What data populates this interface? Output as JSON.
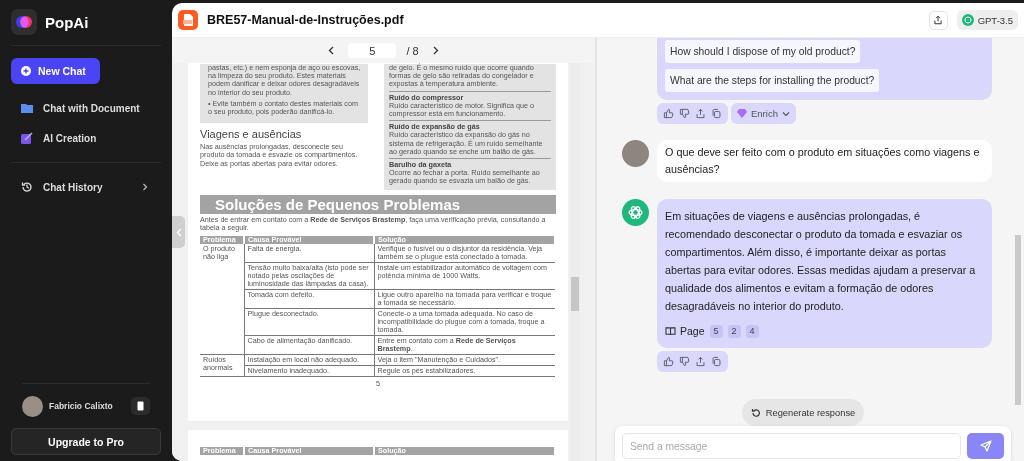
{
  "sidebar": {
    "brand": "PopAi",
    "new_chat": "New Chat",
    "items": [
      {
        "label": "Chat with Document",
        "kind": "document"
      },
      {
        "label": "AI Creation",
        "kind": "creation"
      }
    ],
    "history": "Chat History",
    "user": {
      "name": "Fabricio Calixto"
    },
    "upgrade": "Upgrade to Pro"
  },
  "document": {
    "file_name": "BRE57-Manual-de-Instruções.pdf",
    "page_input": "5",
    "page_total": "/ 8",
    "left_box": [
      "pastas, etc.) e nem esponja de aço ou escovas, na limpeza do seu produto. Estes materiais podem danificar e deixar odores desagradáveis no interior do seu produto.",
      "• Evite também o contato destes materiais com o seu produto, pois poderão danificá-lo."
    ],
    "section_title": "Viagens e ausências",
    "section_text": "Nas ausências prolongadas, desconecte seu produto da tomada e esvazie os compartimentos. Deixe as portas abertas para evitar odores.",
    "noises": [
      {
        "text": "de gelo. É o mesmo ruído que ocorre quando formas de gelo são retiradas do congelador e expostas à temperatura ambiente."
      },
      {
        "title": "Ruído do compressor",
        "text": "Ruído característico de motor. Significa que o compressor está em funcionamento."
      },
      {
        "title": "Ruído de expansão de gás",
        "text": "Ruído característico da expansão do gás no sistema de refrigeração. É um ruído semelhante ao gerado quando se enche um balão de gás."
      },
      {
        "title": "Barulho da gaxeta",
        "text": "Ocorre ao fechar a porta. Ruído semelhante ao gerado quando se esvazia um balão de gás."
      }
    ],
    "heading": "Soluções de Pequenos Problemas",
    "intro": "Antes de entrar em contato com a **Rede de Serviços Brastemp**, faça uma verificação prévia, consultando a tabela a seguir.",
    "table": {
      "columns": [
        "Problema",
        "Causa Provável",
        "Solução"
      ],
      "groups": [
        {
          "problem": "O produto não liga",
          "rows": [
            {
              "cause": "Falta de energia.",
              "solution": "Verifique o fusível ou o disjuntor da residência. Veja também se o plugue está conectado à tomada."
            },
            {
              "cause": "Tensão muito baixa/alta (isto pode ser notado pelas oscilações de luminosidade das lâmpadas da casa).",
              "solution": "Instale um estabilizador automático de voltagem com potência mínima de 1000 Watts."
            },
            {
              "cause": "Tomada com defeito.",
              "solution": "Ligue outro aparelho na tomada para verificar e troque a tomada se necessário."
            },
            {
              "cause": "Plugue desconectado.",
              "solution": "Conecte-o a uma tomada adequada. No caso de incompatibilidade do plugue com a tomada, troque a tomada."
            },
            {
              "cause": "Cabo de alimentação danificado.",
              "solution": "Entre em contato com a **Rede de Serviços Brastemp**."
            }
          ]
        },
        {
          "problem": "Ruídos anormais",
          "rows": [
            {
              "cause": "Instalação em local não adequado.",
              "solution": "Veja o item \"Manutenção e Cuidados\"."
            },
            {
              "cause": "Nivelamento inadequado.",
              "solution": "Regule os pés estabilizadores."
            }
          ]
        }
      ]
    },
    "page_number": "5",
    "next_page_columns": [
      "Problema",
      "Causa Provável",
      "Solução"
    ]
  },
  "chat": {
    "model": "GPT-3.5",
    "suggestions": [
      "How should I dispose of my old product?",
      "What are the steps for installing the product?"
    ],
    "enrich": "Enrich",
    "messages": [
      {
        "kind": "user",
        "text": "O que deve ser feito com o produto em situações como viagens e ausências?"
      },
      {
        "kind": "assistant",
        "text": "Em situações de viagens e ausências prolongadas, é recomendado desconectar o produto da tomada e esvaziar os compartimentos. Além disso, é importante deixar as portas abertas para evitar odores. Essas medidas ajudam a preservar a qualidade dos alimentos e evitam a formação de odores desagradáveis no interior do produto.",
        "page_label": "Page",
        "pages": [
          "5",
          "2",
          "4"
        ]
      }
    ],
    "regenerate": "Regenerate response",
    "input": {
      "placeholder": "Send a message"
    }
  }
}
